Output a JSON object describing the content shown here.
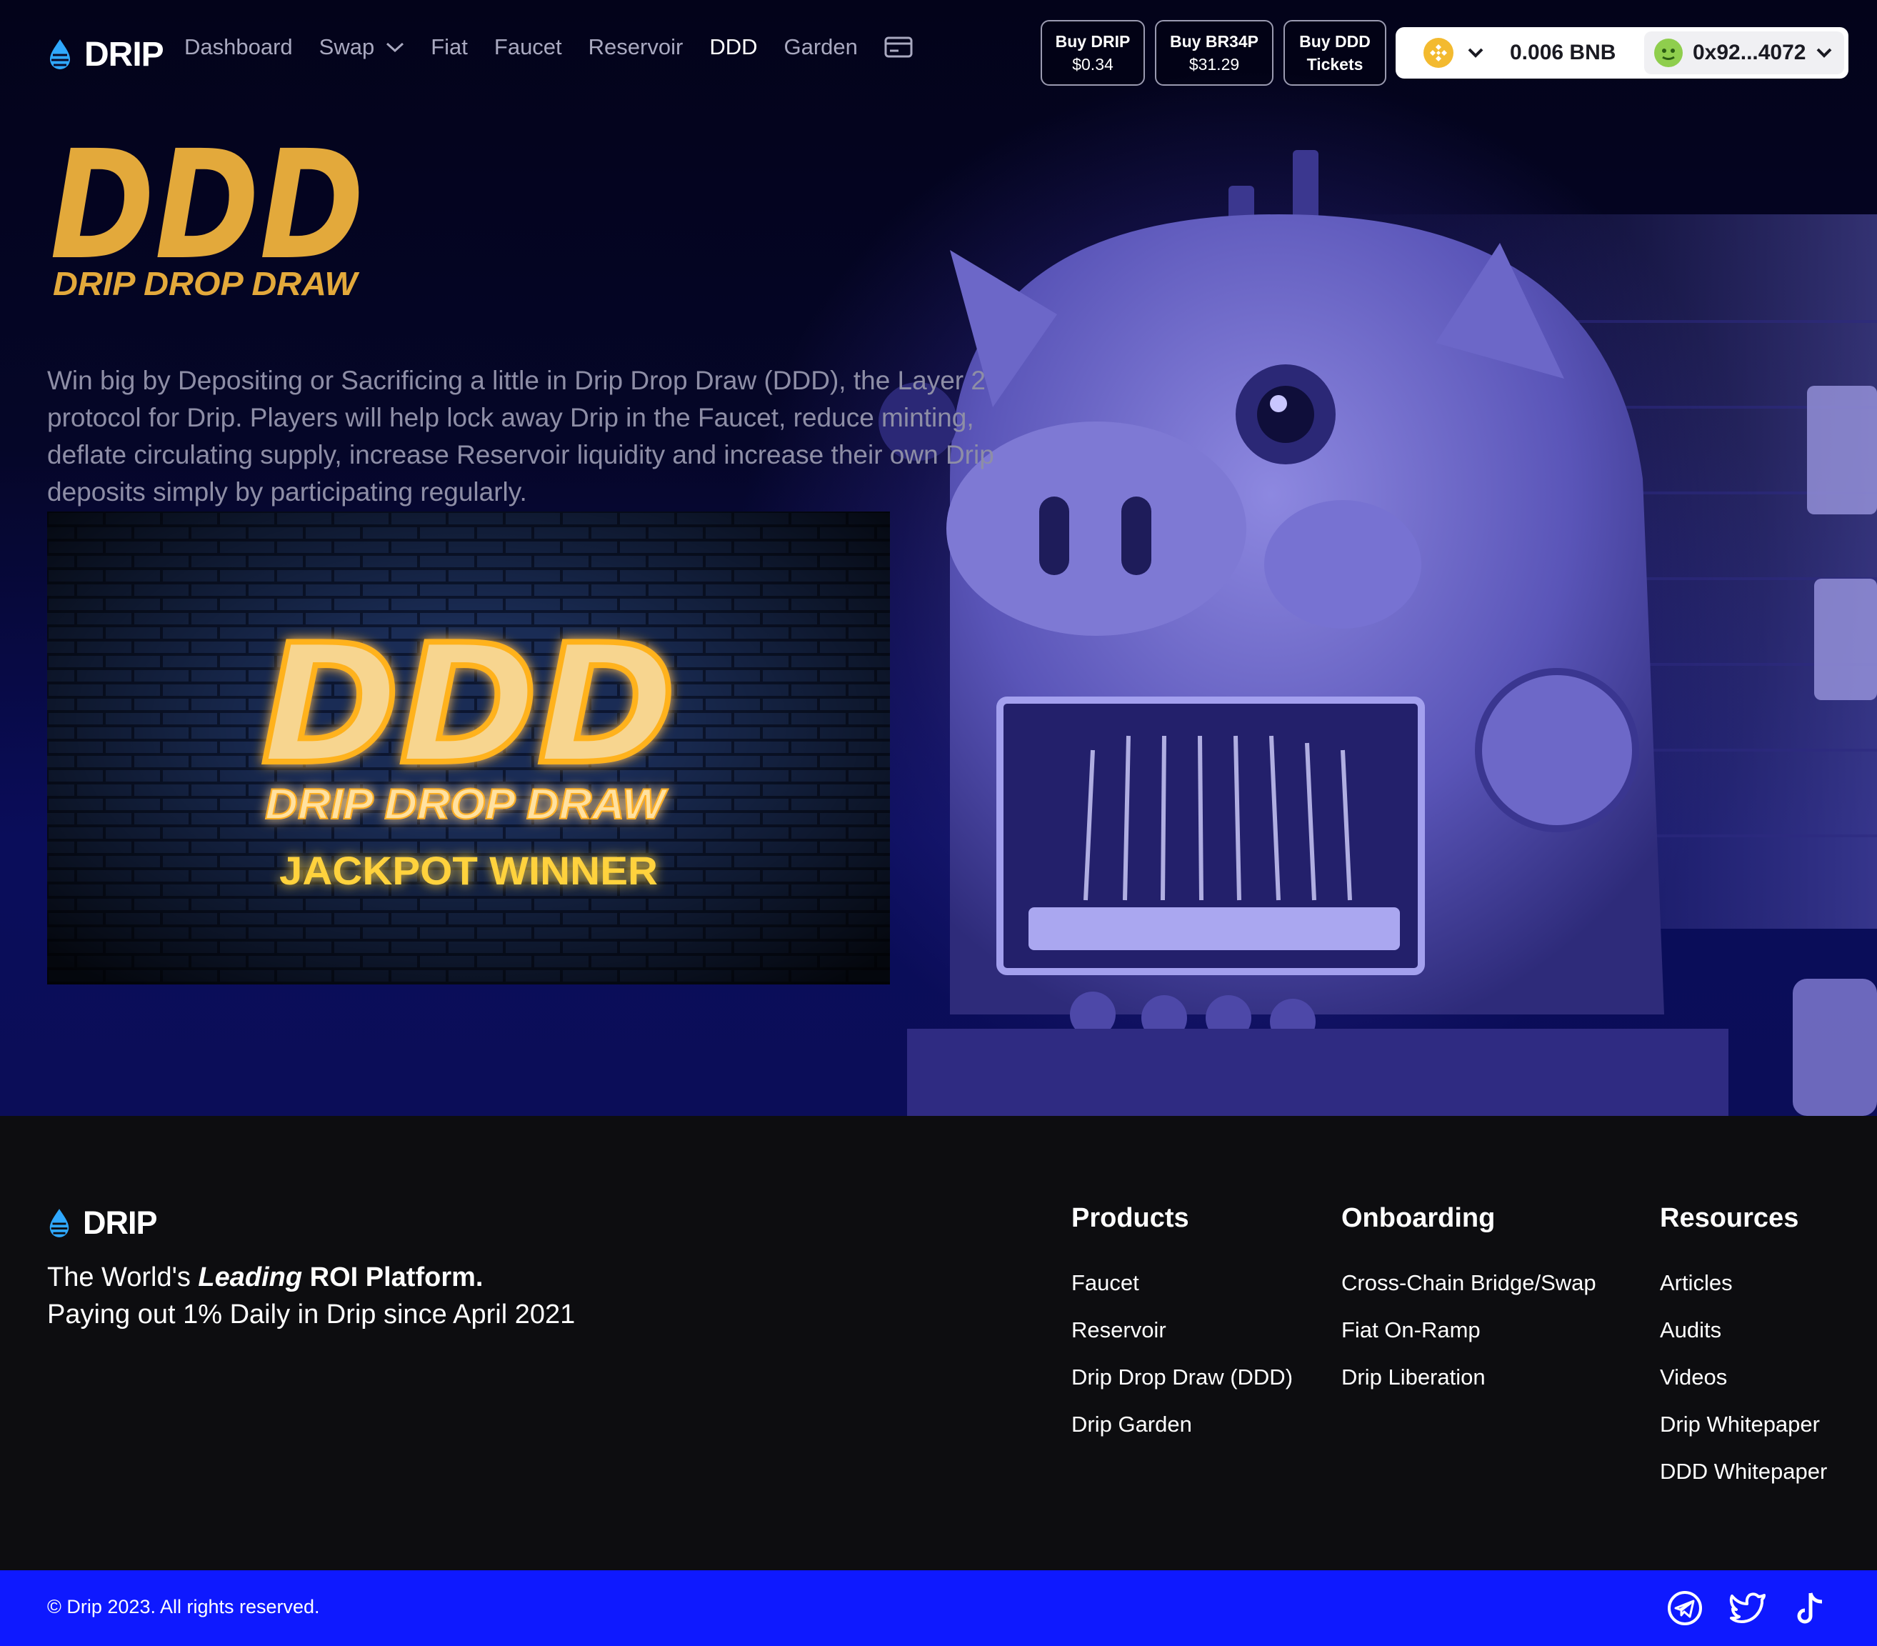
{
  "brand": {
    "name": "DRIP",
    "accent": "#e3a93b",
    "blue": "#0e19ff"
  },
  "nav": {
    "links": [
      {
        "label": "Dashboard",
        "active": false
      },
      {
        "label": "Swap",
        "active": false,
        "dropdown": true
      },
      {
        "label": "Fiat",
        "active": false
      },
      {
        "label": "Faucet",
        "active": false
      },
      {
        "label": "Reservoir",
        "active": false
      },
      {
        "label": "DDD",
        "active": true
      },
      {
        "label": "Garden",
        "active": false
      }
    ],
    "card_icon": "credit-card-icon",
    "buy_drip": {
      "line1": "Buy DRIP",
      "line2": "$0.34"
    },
    "buy_br34p": {
      "line1": "Buy BR34P",
      "line2": "$31.29"
    },
    "buy_ddd": {
      "line1": "Buy DDD",
      "line2": "Tickets"
    },
    "network_icon": "bnb-chain-icon",
    "wallet": {
      "balance": "0.006 BNB",
      "address": "0x92...4072"
    }
  },
  "hero": {
    "logo_big": "DDD",
    "logo_sub": "DRIP DROP DRAW",
    "description": "Win big by Depositing or Sacrificing a little in Drip Drop Draw (DDD), the Layer 2 protocol for Drip. Players will help lock away Drip in the Faucet, reduce minting, deflate circulating supply, increase Reservoir liquidity and increase their own Drip deposits simply by participating regularly.",
    "banner": {
      "big": "DDD",
      "sub": "DRIP DROP DRAW",
      "caption": "JACKPOT WINNER"
    }
  },
  "footer": {
    "brand": "DRIP",
    "tagline_pre": "The World's ",
    "tagline_em": "Leading",
    "tagline_post": " ROI Platform.",
    "tagline_line2": "Paying out 1% Daily in Drip since April 2021",
    "columns": [
      {
        "title": "Products",
        "links": [
          "Faucet",
          "Reservoir",
          "Drip Drop Draw (DDD)",
          "Drip Garden"
        ]
      },
      {
        "title": "Onboarding",
        "links": [
          "Cross-Chain Bridge/Swap",
          "Fiat On-Ramp",
          "Drip Liberation"
        ]
      },
      {
        "title": "Resources",
        "links": [
          "Articles",
          "Audits",
          "Videos",
          "Drip Whitepaper",
          "DDD Whitepaper"
        ]
      }
    ],
    "copyright": "© Drip 2023. All rights reserved.",
    "socials": [
      "telegram-icon",
      "twitter-icon",
      "tiktok-icon"
    ]
  }
}
